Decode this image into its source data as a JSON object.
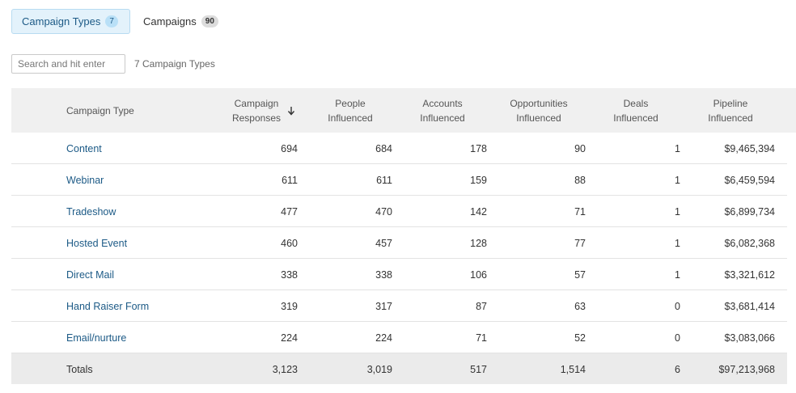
{
  "tabs": [
    {
      "label": "Campaign Types",
      "count": "7"
    },
    {
      "label": "Campaigns",
      "count": "90"
    }
  ],
  "search": {
    "placeholder": "Search and hit enter",
    "count_label": "7 Campaign Types"
  },
  "columns": {
    "type": "Campaign Type",
    "responses": [
      "Campaign",
      "Responses"
    ],
    "people": [
      "People",
      "Influenced"
    ],
    "accounts": [
      "Accounts",
      "Influenced"
    ],
    "opps": [
      "Opportunities",
      "Influenced"
    ],
    "deals": [
      "Deals",
      "Influenced"
    ],
    "pipeline": [
      "Pipeline",
      "Influenced"
    ]
  },
  "sort_icon": "arrow-down-icon",
  "rows": [
    {
      "type": "Content",
      "responses": "694",
      "people": "684",
      "accounts": "178",
      "opps": "90",
      "deals": "1",
      "pipeline": "$9,465,394"
    },
    {
      "type": "Webinar",
      "responses": "611",
      "people": "611",
      "accounts": "159",
      "opps": "88",
      "deals": "1",
      "pipeline": "$6,459,594"
    },
    {
      "type": "Tradeshow",
      "responses": "477",
      "people": "470",
      "accounts": "142",
      "opps": "71",
      "deals": "1",
      "pipeline": "$6,899,734"
    },
    {
      "type": "Hosted Event",
      "responses": "460",
      "people": "457",
      "accounts": "128",
      "opps": "77",
      "deals": "1",
      "pipeline": "$6,082,368"
    },
    {
      "type": "Direct Mail",
      "responses": "338",
      "people": "338",
      "accounts": "106",
      "opps": "57",
      "deals": "1",
      "pipeline": "$3,321,612"
    },
    {
      "type": "Hand Raiser Form",
      "responses": "319",
      "people": "317",
      "accounts": "87",
      "opps": "63",
      "deals": "0",
      "pipeline": "$3,681,414"
    },
    {
      "type": "Email/nurture",
      "responses": "224",
      "people": "224",
      "accounts": "71",
      "opps": "52",
      "deals": "0",
      "pipeline": "$3,083,066"
    }
  ],
  "totals": {
    "label": "Totals",
    "responses": "3,123",
    "people": "3,019",
    "accounts": "517",
    "opps": "1,514",
    "deals": "6",
    "pipeline": "$97,213,968"
  },
  "colors": {
    "accent": "#1c5a86",
    "tab_active_bg": "#e3f2fb",
    "header_bg": "#f0f0f0"
  }
}
